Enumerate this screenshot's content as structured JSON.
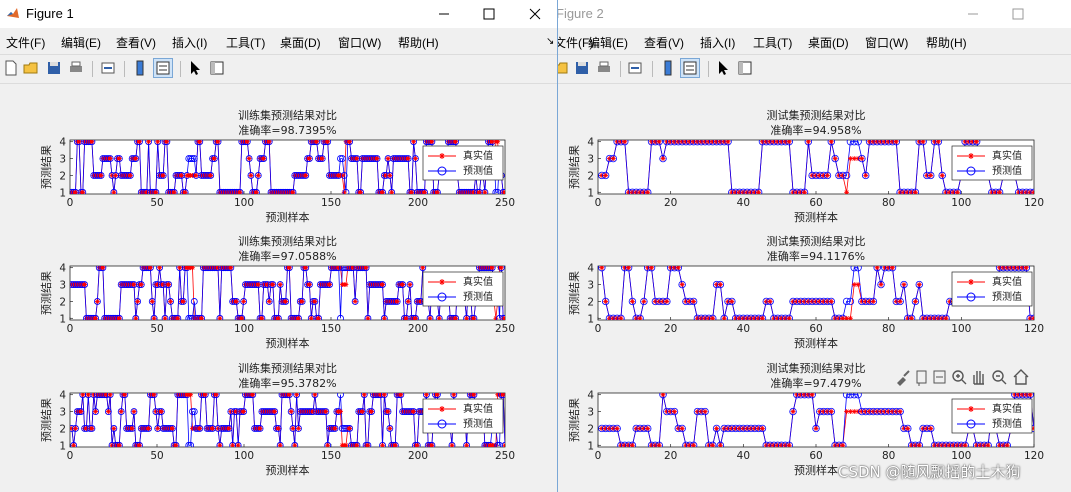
{
  "windows": [
    {
      "title": "Figure 1",
      "menu": [
        "文件(F)",
        "编辑(E)",
        "查看(V)",
        "插入(I)",
        "工具(T)",
        "桌面(D)",
        "窗口(W)",
        "帮助(H)"
      ],
      "dock_arrow": "↘",
      "subplots": [
        {
          "title": "训练集预测结果对比",
          "accuracy": "准确率=98.7395%",
          "xlabel": "预测样本",
          "ylabel": "预测结果",
          "xlim": [
            0,
            250
          ],
          "xticks": [
            "0",
            "50",
            "100",
            "150",
            "200",
            "250"
          ],
          "yticks": [
            "1",
            "2",
            "3",
            "4"
          ]
        },
        {
          "title": "训练集预测结果对比",
          "accuracy": "准确率=97.0588%",
          "xlabel": "预测样本",
          "ylabel": "预测结果",
          "xlim": [
            0,
            250
          ],
          "xticks": [
            "0",
            "50",
            "100",
            "150",
            "200",
            "250"
          ],
          "yticks": [
            "1",
            "2",
            "3",
            "4"
          ]
        },
        {
          "title": "训练集预测结果对比",
          "accuracy": "准确率=95.3782%",
          "xlabel": "预测样本",
          "ylabel": "预测结果",
          "xlim": [
            0,
            250
          ],
          "xticks": [
            "0",
            "50",
            "100",
            "150",
            "200",
            "250"
          ],
          "yticks": [
            "1",
            "2",
            "3",
            "4"
          ]
        }
      ]
    },
    {
      "title": "Figure 2",
      "menu": [
        "文件(F)",
        "编辑(E)",
        "查看(V)",
        "插入(I)",
        "工具(T)",
        "桌面(D)",
        "窗口(W)",
        "帮助(H)"
      ],
      "subplots": [
        {
          "title": "测试集预测结果对比",
          "accuracy": "准确率=94.958%",
          "xlabel": "预测样本",
          "ylabel": "预测结果",
          "xlim": [
            0,
            120
          ],
          "xticks": [
            "0",
            "20",
            "40",
            "60",
            "80",
            "100",
            "120"
          ],
          "yticks": [
            "1",
            "2",
            "3",
            "4"
          ]
        },
        {
          "title": "测试集预测结果对比",
          "accuracy": "准确率=94.1176%",
          "xlabel": "预测样本",
          "ylabel": "预测结果",
          "xlim": [
            0,
            120
          ],
          "xticks": [
            "0",
            "20",
            "40",
            "60",
            "80",
            "100",
            "120"
          ],
          "yticks": [
            "1",
            "2",
            "3",
            "4"
          ]
        },
        {
          "title": "测试集预测结果对比",
          "accuracy": "准确率=97.479%",
          "xlabel": "预测样本",
          "ylabel": "预测结果",
          "xlim": [
            0,
            120
          ],
          "xticks": [
            "0",
            "20",
            "40",
            "60",
            "80",
            "100",
            "120"
          ],
          "yticks": [
            "1",
            "2",
            "3",
            "4"
          ]
        }
      ]
    }
  ],
  "legend": {
    "true_label": "真实值",
    "pred_label": "预测值"
  },
  "colors": {
    "true": "#ff0000",
    "pred": "#0000ff",
    "axes_bg": "#ffffff"
  },
  "watermark": "CSDN @随风飘摇的土木狗",
  "axes_toolbar_icons": [
    "brush-icon",
    "data-tip-icon",
    "legend-icon",
    "zoom-in-icon",
    "pan-icon",
    "zoom-out-icon",
    "home-icon"
  ]
}
